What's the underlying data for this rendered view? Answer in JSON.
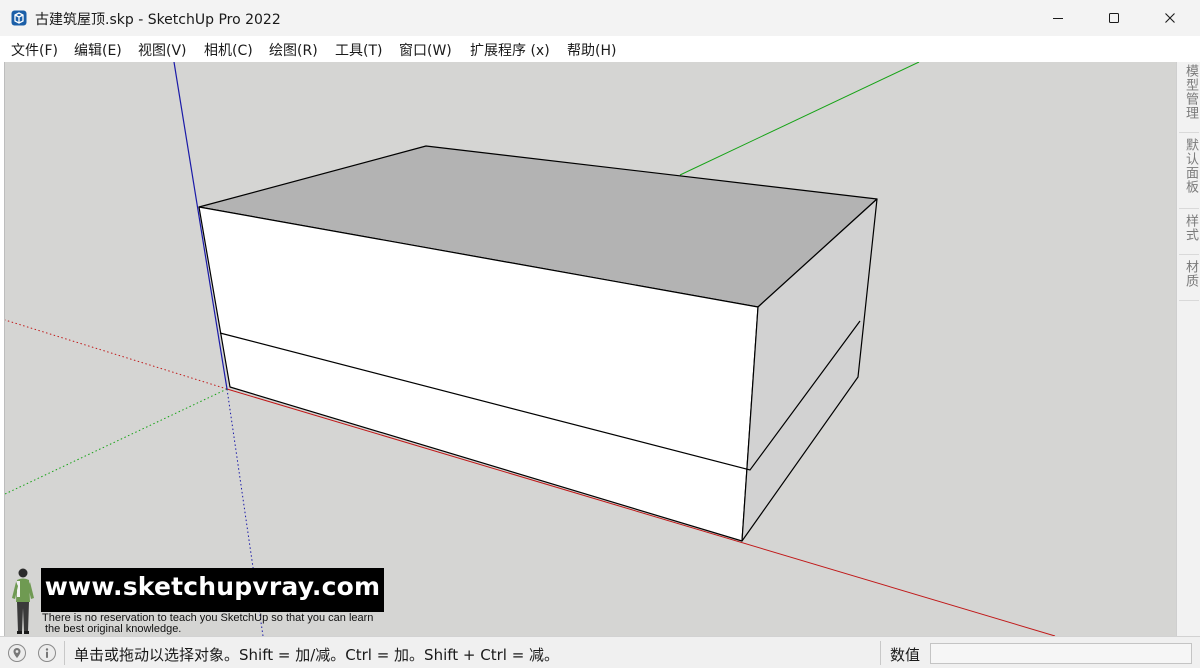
{
  "window": {
    "title": "古建筑屋顶.skp - SketchUp Pro 2022",
    "icon": "sketchup-app-icon",
    "controls": [
      "minimize-icon",
      "maximize-icon",
      "close-icon"
    ]
  },
  "menu": {
    "items": [
      {
        "label": "文件(F)"
      },
      {
        "label": "编辑(E)"
      },
      {
        "label": "视图(V)"
      },
      {
        "label": "相机(C)"
      },
      {
        "label": "绘图(R)"
      },
      {
        "label": "工具(T)"
      },
      {
        "label": "窗口(W)"
      },
      {
        "label": "扩展程序 (x)"
      },
      {
        "label": "帮助(H)"
      }
    ]
  },
  "tray": {
    "tabs": [
      {
        "label": "模型管理"
      },
      {
        "label": "默认面板"
      },
      {
        "label": "样式"
      },
      {
        "label": "材质"
      }
    ]
  },
  "watermark": {
    "url": "www.sketchupvray.com",
    "line1": "There is no reservation to teach you SketchUp so that you can learn",
    "line2": "the best original knowledge."
  },
  "status": {
    "message": "单击或拖动以选择对象。Shift = 加/减。Ctrl = 加。Shift + Ctrl = 减。",
    "measure_label": "数值",
    "measure_value": ""
  },
  "colors": {
    "viewport_bg": "#d5d5d3",
    "axis_red": "#c01818",
    "axis_green": "#16a316",
    "axis_blue": "#1a1aa8",
    "face_front": "#ffffff",
    "face_top": "#b3b3b3",
    "face_side": "#d2d2d2",
    "edge": "#000000"
  }
}
